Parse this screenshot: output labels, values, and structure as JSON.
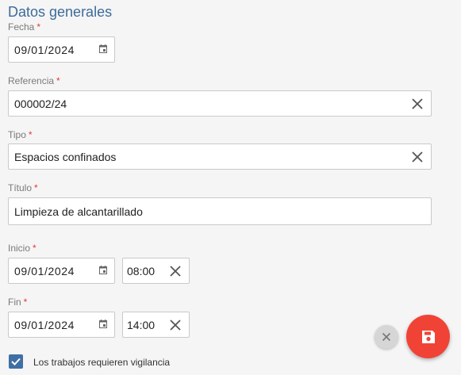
{
  "section": {
    "title": "Datos generales"
  },
  "required_mark": "*",
  "fecha": {
    "label": "Fecha",
    "value": "09/01/2024"
  },
  "referencia": {
    "label": "Referencia",
    "value": "000002/24"
  },
  "tipo": {
    "label": "Tipo",
    "value": "Espacios confinados"
  },
  "titulo": {
    "label": "Título",
    "value": "Limpieza de alcantarillado"
  },
  "inicio": {
    "label": "Inicio",
    "date": "09/01/2024",
    "time": "08:00"
  },
  "fin": {
    "label": "Fin",
    "date": "09/01/2024",
    "time": "14:00"
  },
  "vigilancia": {
    "label": "Los trabajos requieren vigilancia",
    "checked": true
  },
  "icons": {
    "calendar": "calendar-icon",
    "clear": "close-icon",
    "check": "check-icon",
    "save": "floppy-disk-icon"
  },
  "colors": {
    "accent": "#3d6b99",
    "required": "#e53935",
    "checkbox": "#3f6fa5",
    "save_fab": "#f04336",
    "cancel_fab": "#d6d6d6"
  }
}
